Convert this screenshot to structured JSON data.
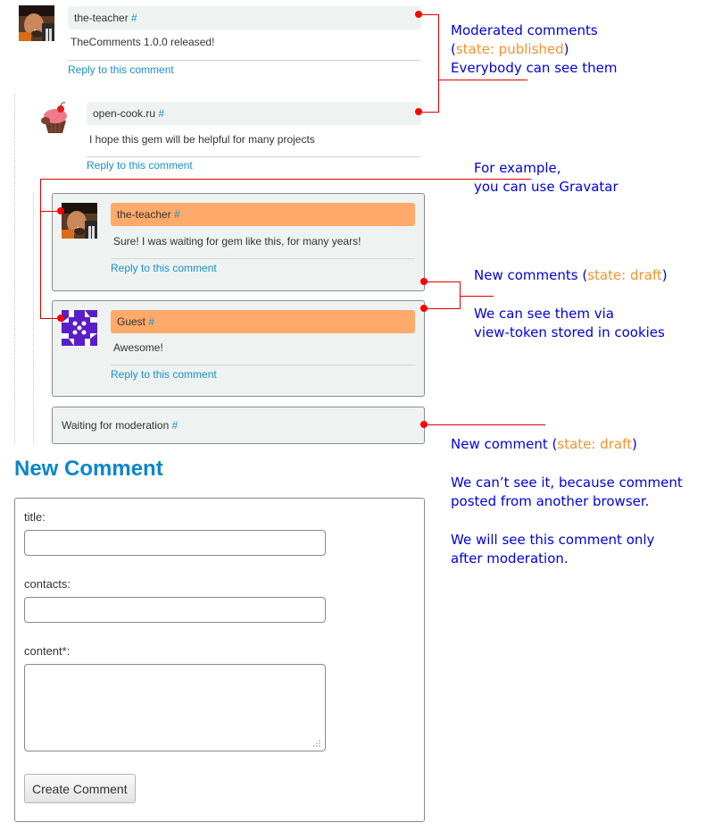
{
  "comments": [
    {
      "author": "the-teacher",
      "anchor": "#",
      "body": "TheComments 1.0.0 released!",
      "reply_label": "Reply to this comment",
      "state": "published",
      "avatar": "teacher-photo"
    },
    {
      "author": "open-cook.ru",
      "anchor": "#",
      "body": "I hope this gem will be helpful for many projects",
      "reply_label": "Reply to this comment",
      "state": "published",
      "avatar": "cupcake-image"
    },
    {
      "author": "the-teacher",
      "anchor": "#",
      "body": "Sure! I was waiting for gem like this, for many years!",
      "reply_label": "Reply to this comment",
      "state": "draft",
      "avatar": "teacher-photo"
    },
    {
      "author": "Guest",
      "anchor": "#",
      "body": "Awesome!",
      "reply_label": "Reply to this comment",
      "state": "draft",
      "avatar": "gravatar-identicon"
    }
  ],
  "moderation_placeholder": {
    "text": "Waiting for moderation",
    "anchor": "#"
  },
  "annotations": {
    "moderated": {
      "line1": "Moderated comments",
      "open_paren": "(",
      "state": "state: published",
      "close_paren": ")",
      "line3": "Everybody can see them"
    },
    "gravatar": {
      "line1": "For example,",
      "line2": "you can use Gravatar"
    },
    "new_comments": {
      "prefix": "New comments (",
      "state": "state: draft",
      "suffix": ")",
      "line2": "We can see them via",
      "line3": "view-token stored in cookies"
    },
    "new_comment": {
      "prefix": "New comment (",
      "state": "state: draft",
      "suffix": ")",
      "line2": "We can’t see it, because comment",
      "line3": "posted from another browser.",
      "line4": "We will see this comment only",
      "line5": "after moderation."
    }
  },
  "form": {
    "title": "New Comment",
    "fields": {
      "title": {
        "label": "title:",
        "value": ""
      },
      "contacts": {
        "label": "contacts:",
        "value": ""
      },
      "content": {
        "label": "content*:",
        "value": ""
      }
    },
    "submit_label": "Create Comment"
  },
  "colors": {
    "link": "#1a8fd0",
    "draft_header": "#ffa96a",
    "published_header": "#eef3f1",
    "annotation_text": "#0000e0",
    "annotation_state": "#f5922a",
    "annotation_line": "#e00000",
    "form_title": "#0a86cc"
  }
}
